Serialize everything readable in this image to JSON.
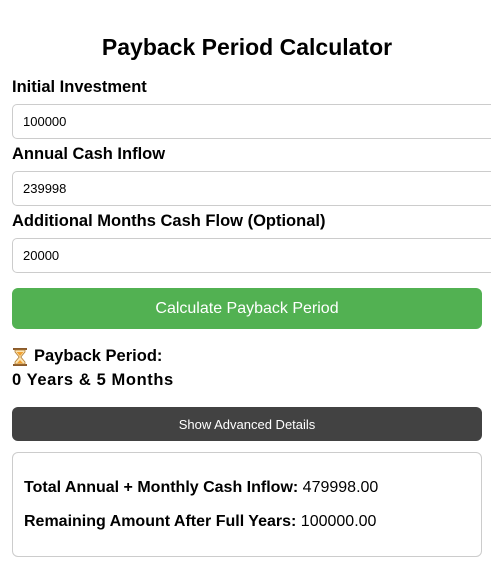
{
  "page": {
    "title": "Payback Period Calculator"
  },
  "form": {
    "initial_investment": {
      "label": "Initial Investment",
      "value": "100000"
    },
    "annual_cash_inflow": {
      "label": "Annual Cash Inflow",
      "value": "239998"
    },
    "additional_months": {
      "label": "Additional Months Cash Flow (Optional)",
      "value": "20000"
    },
    "calculate_label": "Calculate Payback Period"
  },
  "result": {
    "icon": "hourglass-icon",
    "heading": "Payback Period:",
    "value": "0 Years & 5 Months"
  },
  "advanced": {
    "toggle_label": "Show Advanced Details",
    "rows": [
      {
        "label": "Total Annual + Monthly Cash Inflow:",
        "value": "479998.00"
      },
      {
        "label": "Remaining Amount After Full Years:",
        "value": "100000.00"
      }
    ]
  },
  "colors": {
    "calculate_button": "#52b152",
    "advanced_button": "#424242",
    "hourglass": "#f0a030"
  }
}
